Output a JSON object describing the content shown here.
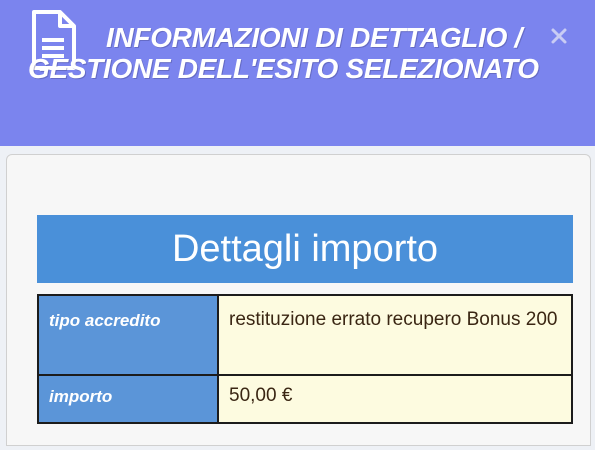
{
  "dialog": {
    "title": "INFORMAZIONI DI DETTAGLIO / GESTIONE DELL'ESITO SELEZIONATO",
    "icon": "document-icon",
    "close_icon": "close-icon",
    "colors": {
      "header": "#7b84ee",
      "card_header": "#4a90d9",
      "label_cell": "#5b95d8",
      "value_cell": "#fdfbe0"
    }
  },
  "card": {
    "heading": "Dettagli importo",
    "rows": [
      {
        "label": "tipo accredito",
        "value": "restituzione errato recupero Bonus 200"
      },
      {
        "label": "importo",
        "value": "50,00 €"
      }
    ]
  }
}
